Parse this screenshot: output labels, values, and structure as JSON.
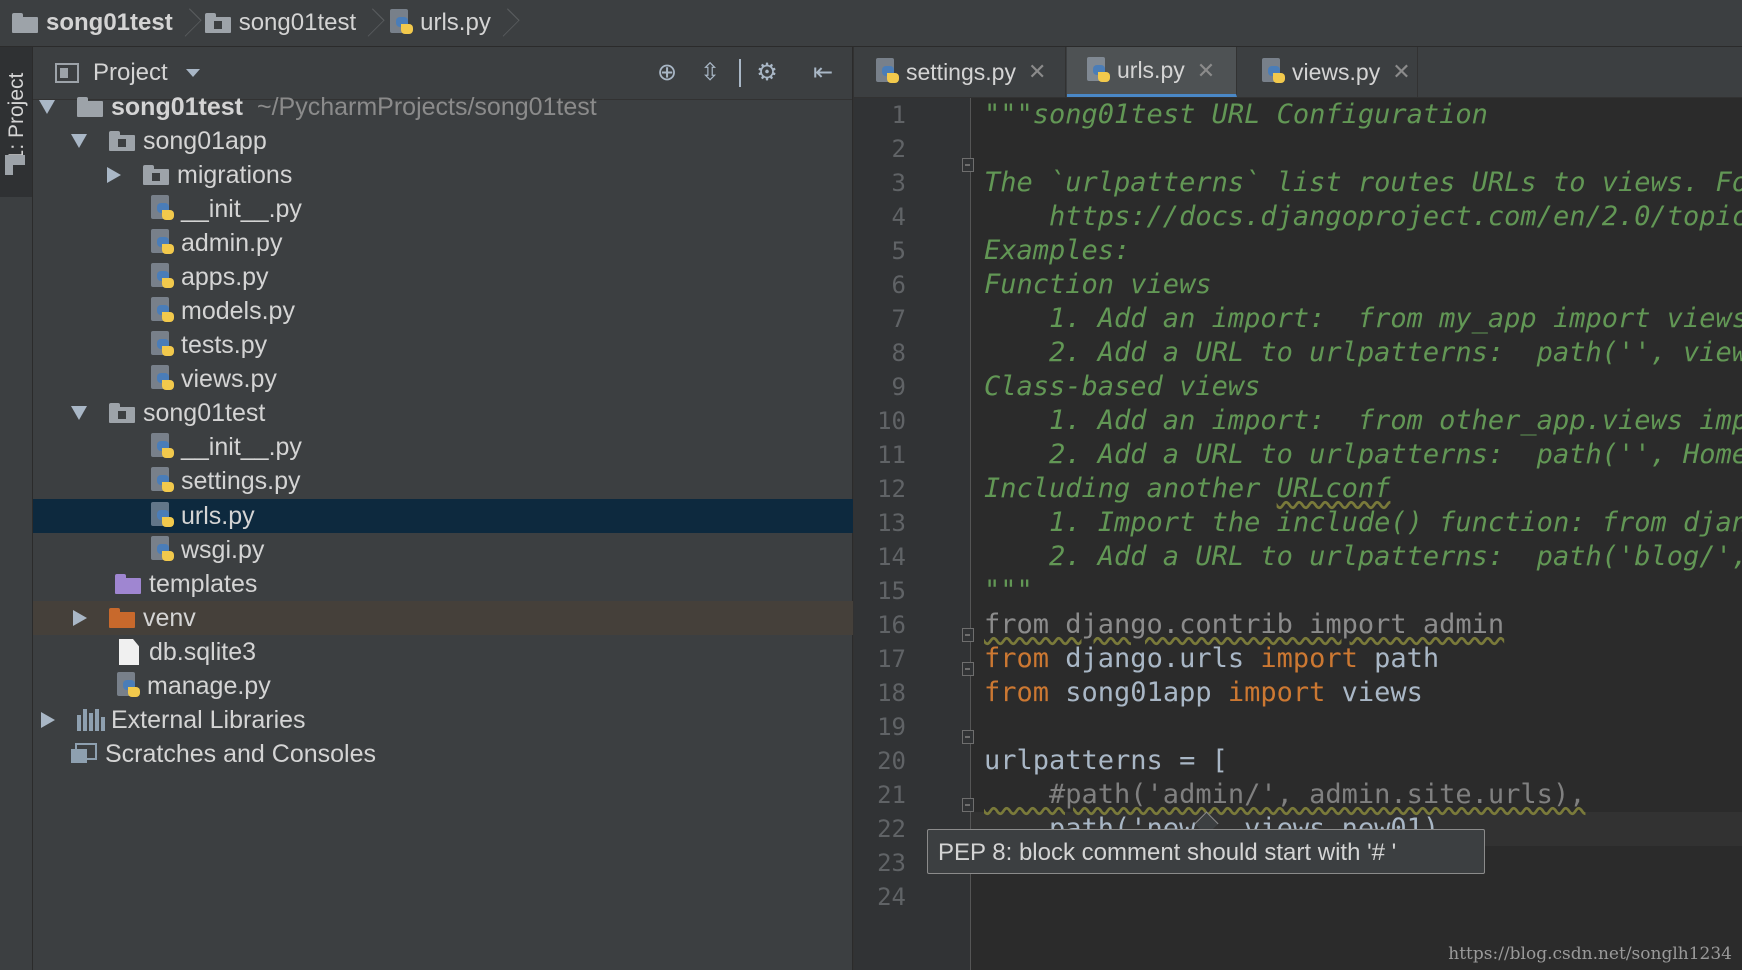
{
  "breadcrumb": {
    "items": [
      "song01test",
      "song01test",
      "urls.py"
    ]
  },
  "tool_window": {
    "label": "1: Project"
  },
  "project_panel": {
    "title": "Project",
    "header_icons": [
      "crosshair-icon",
      "collapse-icon",
      "gear-icon",
      "hide-icon"
    ],
    "tree": [
      {
        "label": "song01test",
        "suffix": "~/PycharmProjects/song01test"
      },
      {
        "label": "song01app"
      },
      {
        "label": "migrations"
      },
      {
        "label": "__init__.py"
      },
      {
        "label": "admin.py"
      },
      {
        "label": "apps.py"
      },
      {
        "label": "models.py"
      },
      {
        "label": "tests.py"
      },
      {
        "label": "views.py"
      },
      {
        "label": "song01test"
      },
      {
        "label": "__init__.py"
      },
      {
        "label": "settings.py"
      },
      {
        "label": "urls.py"
      },
      {
        "label": "wsgi.py"
      },
      {
        "label": "templates"
      },
      {
        "label": "venv"
      },
      {
        "label": "db.sqlite3"
      },
      {
        "label": "manage.py"
      },
      {
        "label": "External Libraries"
      },
      {
        "label": "Scratches and Consoles"
      }
    ]
  },
  "editor": {
    "tabs": [
      {
        "label": "settings.py"
      },
      {
        "label": "urls.py"
      },
      {
        "label": "views.py"
      }
    ],
    "close_glyph": "✕",
    "line_numbers": [
      "1",
      "2",
      "3",
      "4",
      "5",
      "6",
      "7",
      "8",
      "9",
      "10",
      "11",
      "12",
      "13",
      "14",
      "15",
      "16",
      "17",
      "18",
      "19",
      "20",
      "21",
      "22",
      "23",
      "24"
    ],
    "code": {
      "l1": "\"\"\"song01test URL Configuration",
      "l3": "The `urlpatterns` list routes URLs to views. For",
      "l4": "    https://docs.djangoproject.com/en/2.0/topics",
      "l5": "Examples:",
      "l6": "Function views",
      "l7": "    1. Add an import:  from my_app import views",
      "l8": "    2. Add a URL to urlpatterns:  path('', views",
      "l9": "Class-based views",
      "l10": "    1. Add an import:  from other_app.views impo",
      "l11": "    2. Add a URL to urlpatterns:  path('', Home.",
      "l12a": "Including another ",
      "l12b": "URLconf",
      "l13": "    1. Import the include() function: from djang",
      "l14": "    2. Add a URL to urlpatterns:  path('blog/', ",
      "l15": "\"\"\"",
      "l16": "from django.contrib import admin",
      "l17_kw1": "from",
      "l17_mod": " django.urls ",
      "l17_kw2": "import",
      "l17_name": " path",
      "l18_kw1": "from",
      "l18_mod": " song01app ",
      "l18_kw2": "import",
      "l18_name": " views",
      "l20": "urlpatterns = [",
      "l21": "    #path('admin/', admin.site.urls),",
      "l22": "    path('new', views.new01)"
    },
    "tooltip": "PEP 8: block comment should start with '# '"
  },
  "watermark": "https://blog.csdn.net/songlh1234",
  "colors": {
    "background": "#2b2b2b",
    "panel": "#3c3f41",
    "selection": "#0d293e",
    "docstring": "#629755",
    "keyword": "#cc7832",
    "comment": "#808080"
  }
}
